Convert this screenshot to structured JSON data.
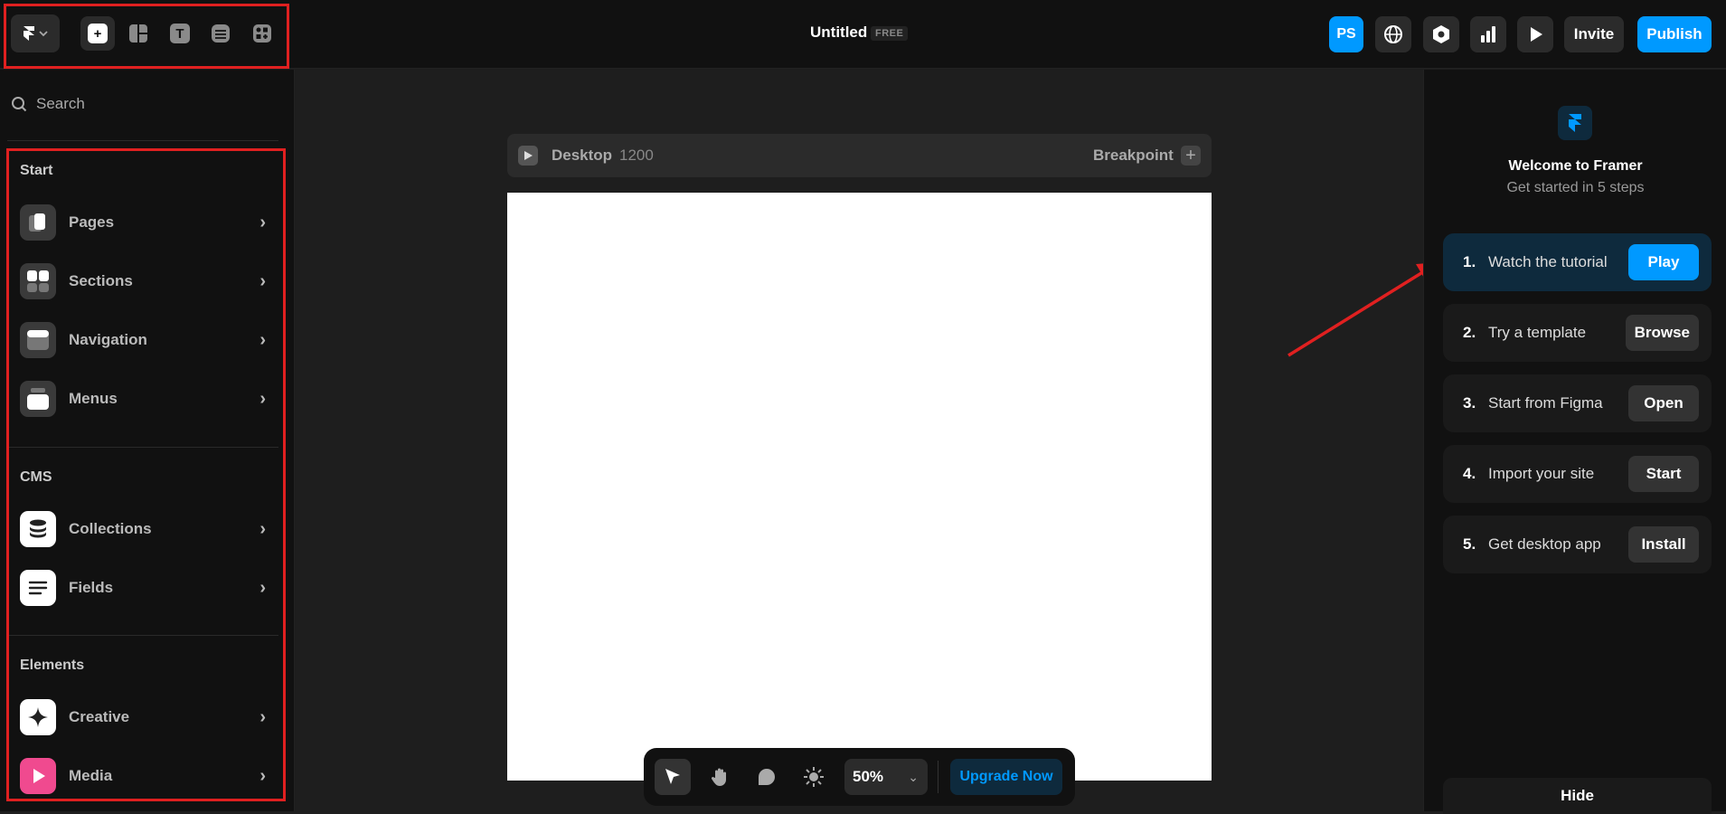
{
  "header": {
    "title": "Untitled",
    "plan_badge": "FREE",
    "avatar_initials": "PS",
    "invite_label": "Invite",
    "publish_label": "Publish",
    "insert_icons": [
      "plus-icon",
      "layout-icon",
      "text-icon",
      "database-icon",
      "components-icon"
    ],
    "accent": "#0099ff"
  },
  "sidebar": {
    "search_placeholder": "Search",
    "sections": [
      {
        "title": "Start",
        "items": [
          {
            "label": "Pages"
          },
          {
            "label": "Sections"
          },
          {
            "label": "Navigation"
          },
          {
            "label": "Menus"
          }
        ]
      },
      {
        "title": "CMS",
        "items": [
          {
            "label": "Collections"
          },
          {
            "label": "Fields"
          }
        ]
      },
      {
        "title": "Elements",
        "items": [
          {
            "label": "Creative"
          },
          {
            "label": "Media"
          }
        ]
      }
    ]
  },
  "canvas": {
    "breakpoint_name": "Desktop",
    "breakpoint_width": "1200",
    "breakpoint_label": "Breakpoint"
  },
  "welcome": {
    "title": "Welcome to Framer",
    "subtitle": "Get started in 5 steps",
    "steps": [
      {
        "num": "1.",
        "label": "Watch the tutorial",
        "action": "Play"
      },
      {
        "num": "2.",
        "label": "Try a template",
        "action": "Browse"
      },
      {
        "num": "3.",
        "label": "Start from Figma",
        "action": "Open"
      },
      {
        "num": "4.",
        "label": "Import your site",
        "action": "Start"
      },
      {
        "num": "5.",
        "label": "Get desktop app",
        "action": "Install"
      }
    ],
    "hide_label": "Hide"
  },
  "bottom_toolbar": {
    "zoom": "50%",
    "upgrade_label": "Upgrade Now"
  },
  "annotations": {
    "highlight_color": "#e02020"
  }
}
